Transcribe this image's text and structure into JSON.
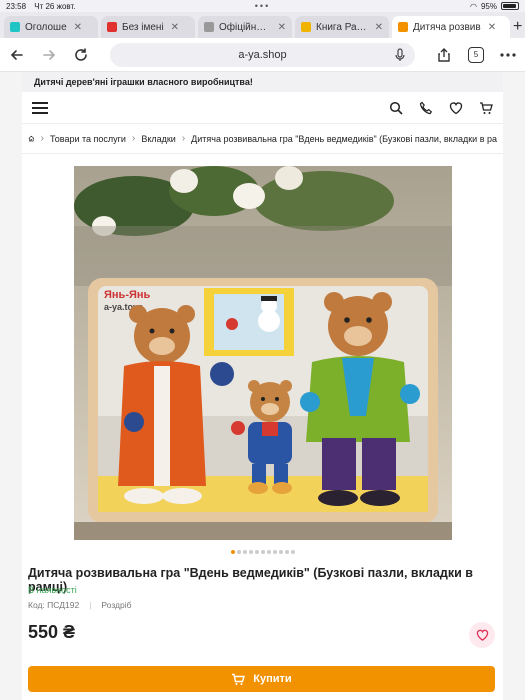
{
  "status_bar": {
    "time": "23:58",
    "date": "Чт 26 жовт.",
    "dots": "•••",
    "battery": "95%"
  },
  "tabs": [
    {
      "label": "Оголоше",
      "color": "#1fc4c4"
    },
    {
      "label": "Без імені",
      "color": "#e0312f"
    },
    {
      "label": "Офіційна карт",
      "color": "#999999"
    },
    {
      "label": "Книга Развива",
      "color": "#f0b400"
    },
    {
      "label": "Дитяча розвив",
      "color": "#f39200"
    }
  ],
  "toolbar": {
    "url": "a-ya.shop",
    "tab_count": "5"
  },
  "site": {
    "banner": "Дитячі дерев'яні іграшки власного виробництва!",
    "breadcrumbs": [
      "Товари та послуги",
      "Вкладки",
      "Дитяча розвивальна гра \"Вдень ведмедиків\" (Бузкові пазли, вкладки в ра"
    ],
    "product": {
      "title": "Дитяча розвивальна гра \"Вдень ведмедиків\" (Бузкові пазли, вкладки в рамці)",
      "stock": "В наявності",
      "code": "Код: ПСД192",
      "retail": "Роздріб",
      "price": "550 ₴",
      "buy_label": "Купити",
      "image_brand": "Янь-Янь",
      "image_site": "a-ya.toys"
    },
    "gallery": {
      "count": 11,
      "active": 0
    }
  },
  "colors": {
    "accent": "#f39200",
    "stock": "#3aa655",
    "heart": "#e0325a"
  }
}
